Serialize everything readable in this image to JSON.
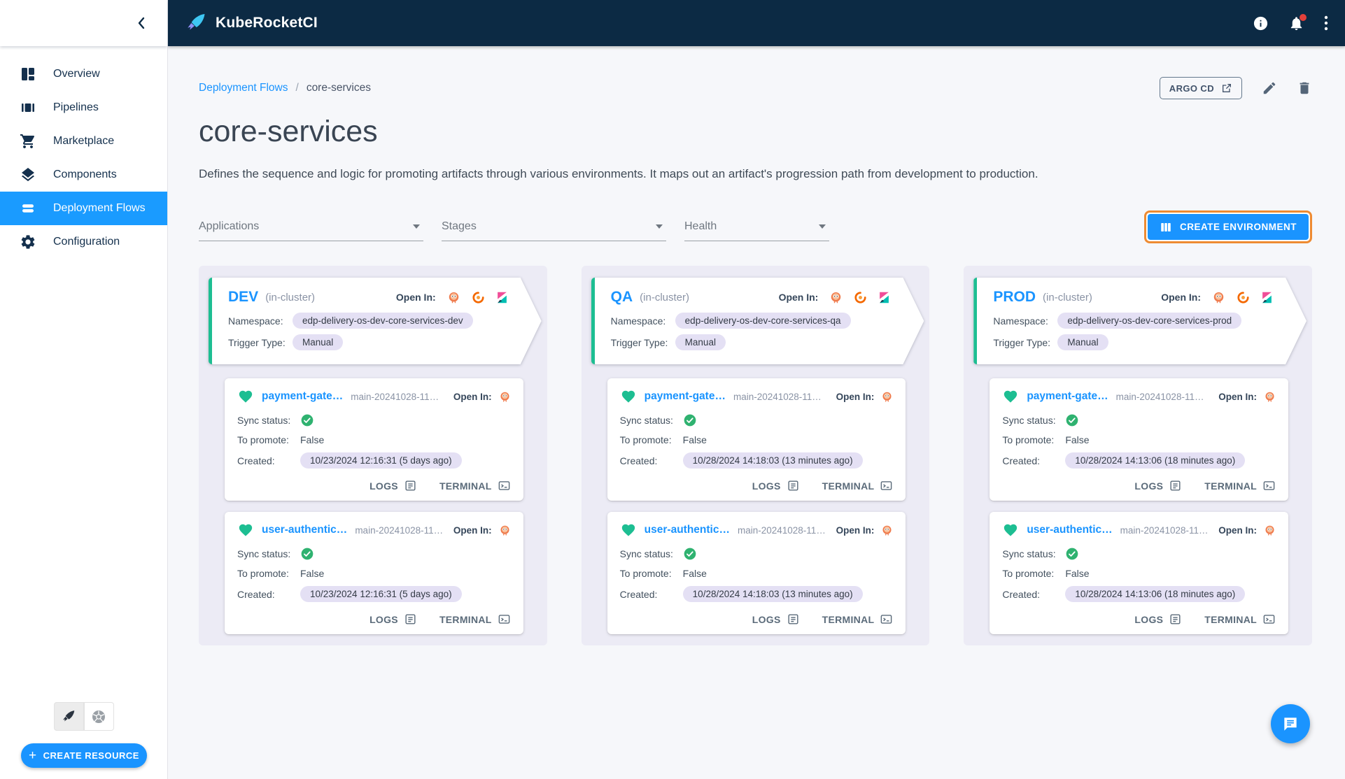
{
  "app": {
    "title": "KubeRocketCI"
  },
  "appbar": {
    "icons": [
      "info-icon",
      "notifications-icon",
      "kebab-menu-icon"
    ],
    "notification_badge": true
  },
  "sidebar": {
    "items": [
      {
        "label": "Overview",
        "icon": "dashboard-icon",
        "active": false
      },
      {
        "label": "Pipelines",
        "icon": "pipelines-icon",
        "active": false
      },
      {
        "label": "Marketplace",
        "icon": "cart-icon",
        "active": false
      },
      {
        "label": "Components",
        "icon": "layers-icon",
        "active": false
      },
      {
        "label": "Deployment Flows",
        "icon": "stacked-bars-icon",
        "active": true
      },
      {
        "label": "Configuration",
        "icon": "gear-icon",
        "active": false
      }
    ],
    "view_toggles": [
      "rocket-view-icon",
      "kubernetes-view-icon"
    ],
    "create_resource_label": "CREATE RESOURCE"
  },
  "breadcrumb": {
    "parent": "Deployment Flows",
    "separator": "/",
    "current": "core-services"
  },
  "page": {
    "title": "core-services",
    "description": "Defines the sequence and logic for promoting artifacts through various environments. It maps out an artifact's progression path from development to production.",
    "argo_button_label": "ARGO CD",
    "header_actions": [
      "edit-pencil-icon",
      "delete-trash-icon"
    ]
  },
  "filters": {
    "applications_label": "Applications",
    "stages_label": "Stages",
    "health_label": "Health"
  },
  "create_environment_label": "CREATE ENVIRONMENT",
  "labels": {
    "open_in": "Open In:",
    "namespace": "Namespace:",
    "trigger_type": "Trigger Type:",
    "sync_status": "Sync status:",
    "to_promote": "To promote:",
    "created": "Created:",
    "logs": "LOGS",
    "terminal": "TERMINAL"
  },
  "environments": [
    {
      "name": "DEV",
      "cluster": "(in-cluster)",
      "namespace": "edp-delivery-os-dev-core-services-dev",
      "trigger": "Manual",
      "open_in_icons": [
        "argocd-icon",
        "grafana-icon",
        "kibana-icon"
      ],
      "applications": [
        {
          "name": "payment-gate…",
          "version": "main-20241028-11…",
          "sync": "synced",
          "promote": "False",
          "created": "10/23/2024 12:16:31 (5 days ago)"
        },
        {
          "name": "user-authentic…",
          "version": "main-20241028-11…",
          "sync": "synced",
          "promote": "False",
          "created": "10/23/2024 12:16:31 (5 days ago)"
        }
      ]
    },
    {
      "name": "QA",
      "cluster": "(in-cluster)",
      "namespace": "edp-delivery-os-dev-core-services-qa",
      "trigger": "Manual",
      "open_in_icons": [
        "argocd-icon",
        "grafana-icon",
        "kibana-icon"
      ],
      "applications": [
        {
          "name": "payment-gate…",
          "version": "main-20241028-11…",
          "sync": "synced",
          "promote": "False",
          "created": "10/28/2024 14:18:03 (13 minutes ago)"
        },
        {
          "name": "user-authentic…",
          "version": "main-20241028-11…",
          "sync": "synced",
          "promote": "False",
          "created": "10/28/2024 14:18:03 (13 minutes ago)"
        }
      ]
    },
    {
      "name": "PROD",
      "cluster": "(in-cluster)",
      "namespace": "edp-delivery-os-dev-core-services-prod",
      "trigger": "Manual",
      "open_in_icons": [
        "argocd-icon",
        "grafana-icon",
        "kibana-icon"
      ],
      "applications": [
        {
          "name": "payment-gate…",
          "version": "main-20241028-11…",
          "sync": "synced",
          "promote": "False",
          "created": "10/28/2024 14:13:06 (18 minutes ago)"
        },
        {
          "name": "user-authentic…",
          "version": "main-20241028-11…",
          "sync": "synced",
          "promote": "False",
          "created": "10/28/2024 14:13:06 (18 minutes ago)"
        }
      ]
    }
  ],
  "status_icons": {
    "healthy": "green-heart-icon",
    "synced": "green-check-circle-icon"
  },
  "chat_fab_icon": "chat-bubble-icon",
  "colors": {
    "appbar_navy": "#0c2a44",
    "accent_blue": "#1a94ff",
    "healthy_green": "#1dbe92",
    "synced_green": "#2fb270",
    "focus_orange": "#ee8b32",
    "column_bg": "#ecebf5",
    "pill_bg": "#e4e0f4",
    "notification_red": "#e4403a"
  }
}
